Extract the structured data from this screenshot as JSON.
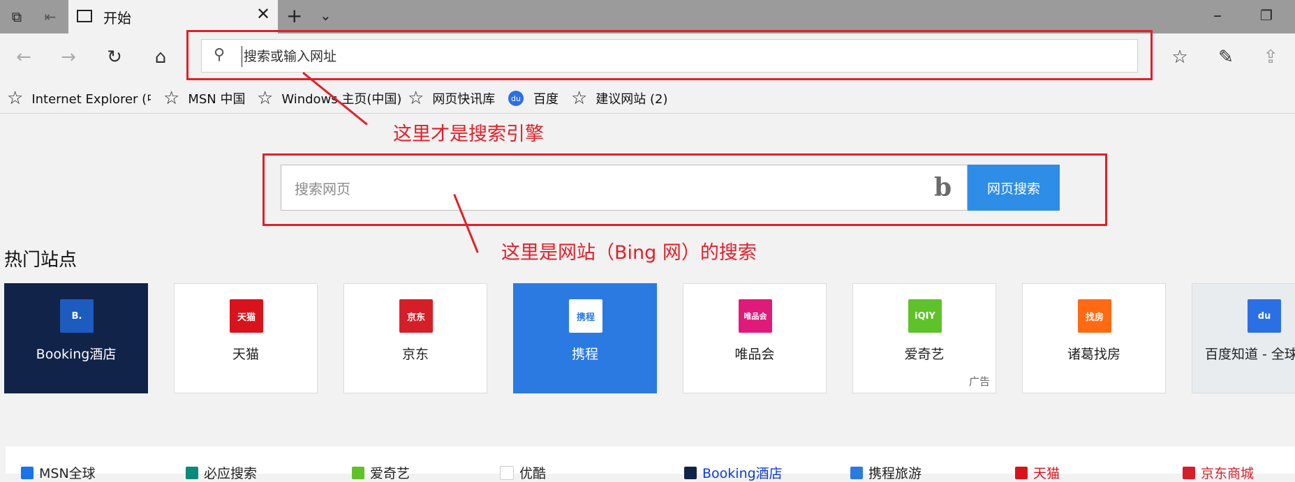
{
  "browser": {
    "tab_title": "开始",
    "address_placeholder": "搜索或输入网址"
  },
  "favorites": [
    {
      "label": "Internet Explorer (中国)",
      "icon": "star-icon"
    },
    {
      "label": "MSN 中国",
      "icon": "star-icon"
    },
    {
      "label": "Windows 主页(中国)",
      "icon": "star-icon"
    },
    {
      "label": "网页快讯库",
      "icon": "star-icon"
    },
    {
      "label": "百度",
      "icon": "baidu-icon"
    },
    {
      "label": "建议网站 (2)",
      "icon": "star-icon"
    }
  ],
  "annotations": {
    "address_note": "这里才是搜索引擎",
    "bing_note": "这里是网站（Bing 网）的搜索"
  },
  "bing": {
    "placeholder": "搜索网页",
    "button": "网页搜索",
    "logo": "b"
  },
  "hot_sites": {
    "title": "热门站点",
    "tiles": [
      {
        "label": "Booking酒店",
        "logo_text": "B.",
        "bg": "#12234a",
        "logo_bg": "#1d5bbf",
        "dark": true
      },
      {
        "label": "天猫",
        "logo_text": "天猫",
        "bg": "#ffffff",
        "logo_bg": "#d9131c"
      },
      {
        "label": "京东",
        "logo_text": "京东",
        "bg": "#ffffff",
        "logo_bg": "#d51f28"
      },
      {
        "label": "携程",
        "logo_text": "携程",
        "bg": "#2a7ae2",
        "logo_bg": "#ffffff",
        "dark": true
      },
      {
        "label": "唯品会",
        "logo_text": "唯品会",
        "bg": "#ffffff",
        "logo_bg": "#e01a7a"
      },
      {
        "label": "爱奇艺",
        "logo_text": "iQIY",
        "bg": "#ffffff",
        "logo_bg": "#5fc22b",
        "ad": "广告"
      },
      {
        "label": "诸葛找房",
        "logo_text": "找房",
        "bg": "#ffffff",
        "logo_bg": "#ff6a13"
      },
      {
        "label": "百度知道 - 全球",
        "logo_text": "du",
        "bg": "#e9ecef",
        "logo_bg": "#2b6fe5"
      }
    ]
  },
  "bottom_links": [
    {
      "label": "MSN全球",
      "color": "#222222",
      "icon_color": "#1a73e8"
    },
    {
      "label": "必应搜索",
      "color": "#222222",
      "icon_color": "#0a8a7a"
    },
    {
      "label": "爱奇艺",
      "color": "#222222",
      "icon_color": "#5fc22b"
    },
    {
      "label": "优酷",
      "color": "#222222",
      "icon_color": "#ffffff"
    },
    {
      "label": "Booking酒店",
      "color": "#0b3bd4",
      "icon_color": "#12234a"
    },
    {
      "label": "携程旅游",
      "color": "#222222",
      "icon_color": "#2a7ae2"
    },
    {
      "label": "天猫",
      "color": "#d9131c",
      "icon_color": "#d9131c"
    },
    {
      "label": "京东商城",
      "color": "#d51f28",
      "icon_color": "#d51f28"
    }
  ]
}
